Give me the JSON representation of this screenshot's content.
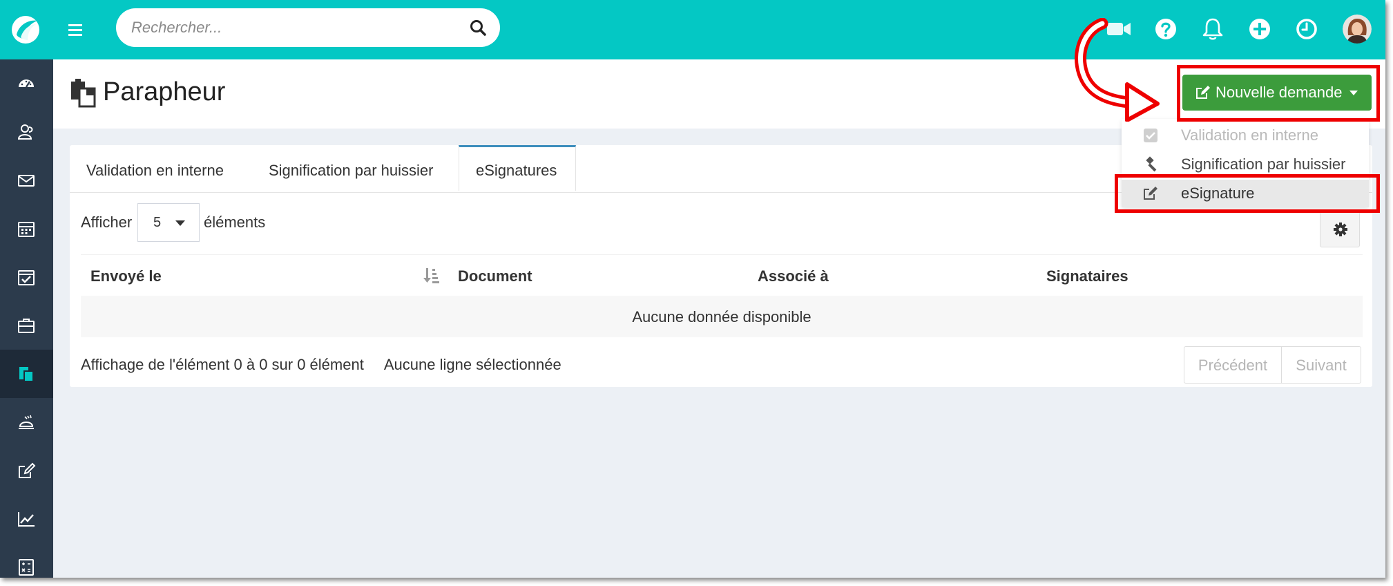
{
  "search": {
    "placeholder": "Rechercher..."
  },
  "topbar_icons": [
    "video-icon",
    "help-icon",
    "bell-icon",
    "plus-circle-icon",
    "clock-icon"
  ],
  "sidebar": {
    "items": [
      {
        "icon": "dashboard-icon"
      },
      {
        "icon": "contacts-icon"
      },
      {
        "icon": "mail-icon"
      },
      {
        "icon": "calendar-icon"
      },
      {
        "icon": "calendar-check-icon"
      },
      {
        "icon": "briefcase-icon"
      },
      {
        "icon": "parapheur-icon",
        "active": true
      },
      {
        "icon": "service-bell-icon"
      },
      {
        "icon": "edit-icon"
      },
      {
        "icon": "chart-icon"
      },
      {
        "icon": "calculator-icon"
      }
    ]
  },
  "page": {
    "title": "Parapheur"
  },
  "new_request": {
    "label": "Nouvelle demande",
    "menu": [
      {
        "label": "Validation en interne",
        "state": "disabled"
      },
      {
        "label": "Signification par huissier",
        "state": "normal"
      },
      {
        "label": "eSignature",
        "state": "hover"
      }
    ]
  },
  "tabs": [
    {
      "label": "Validation en interne"
    },
    {
      "label": "Signification par huissier"
    },
    {
      "label": "eSignatures",
      "active": true
    }
  ],
  "length_menu": {
    "prefix": "Afficher",
    "value": "5",
    "suffix": "éléments"
  },
  "table": {
    "columns": [
      "Envoyé le",
      "Document",
      "Associé à",
      "Signataires"
    ],
    "empty_text": "Aucune donnée disponible"
  },
  "footer": {
    "info": "Affichage de l'élément 0 à 0 sur 0 élément",
    "selection": "Aucune ligne sélectionnée",
    "prev": "Précédent",
    "next": "Suivant"
  },
  "colors": {
    "topbar": "#04c8c4",
    "sidebar": "#2c3b4c",
    "primary_button": "#3c9c3c",
    "highlight": "#ee0000",
    "tab_accent": "#3c8dbc"
  }
}
